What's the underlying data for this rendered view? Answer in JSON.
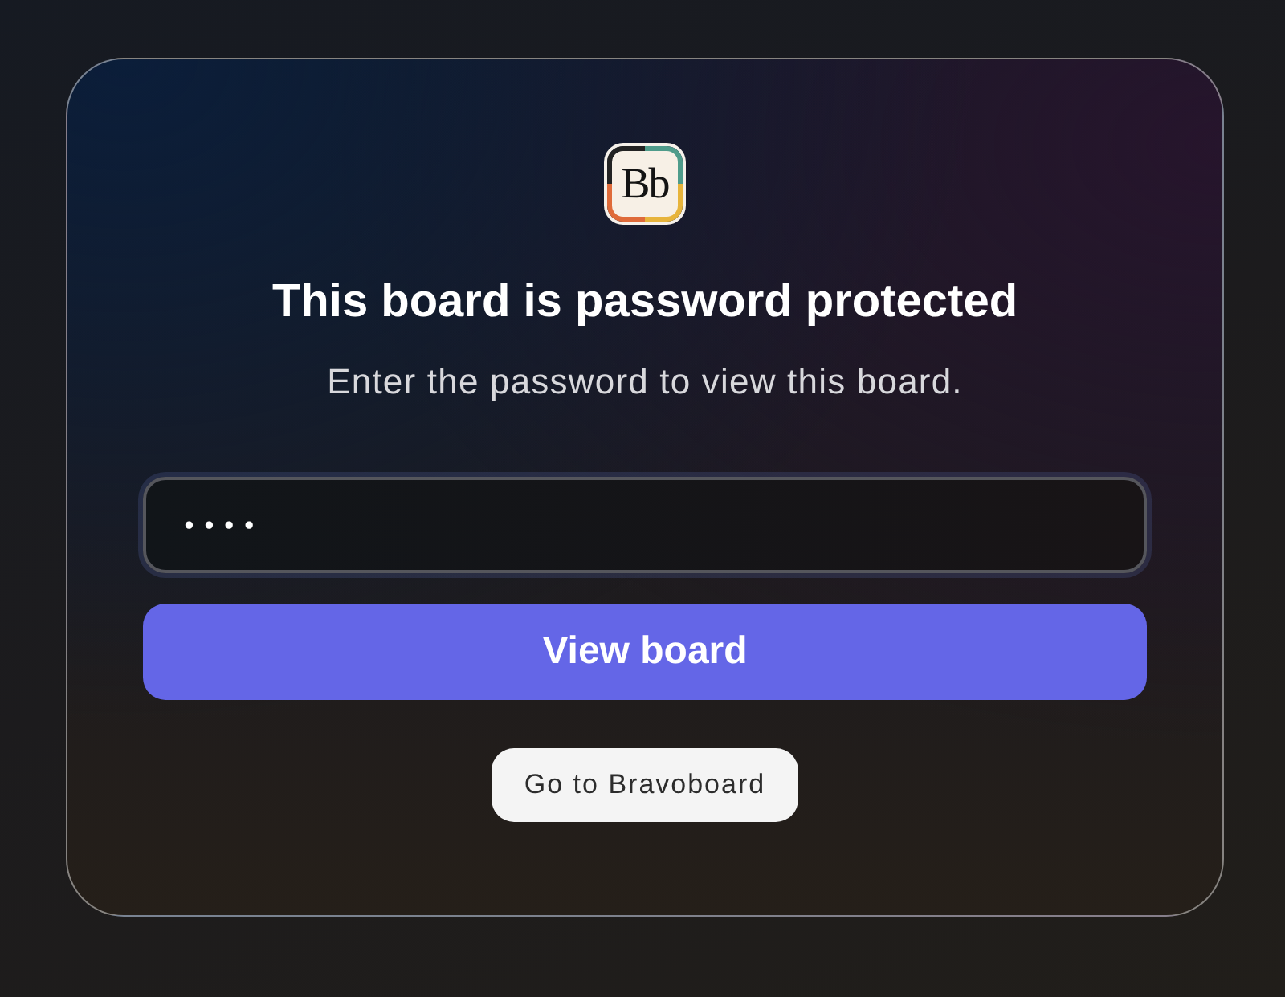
{
  "logo": {
    "text": "Bb"
  },
  "title": "This board is password protected",
  "subtitle": "Enter the password to view this board.",
  "password_field": {
    "value": "••••"
  },
  "buttons": [
    {
      "kind": "primary",
      "label": "View board"
    },
    {
      "kind": "secondary",
      "label": "Go to Bravoboard"
    }
  ]
}
